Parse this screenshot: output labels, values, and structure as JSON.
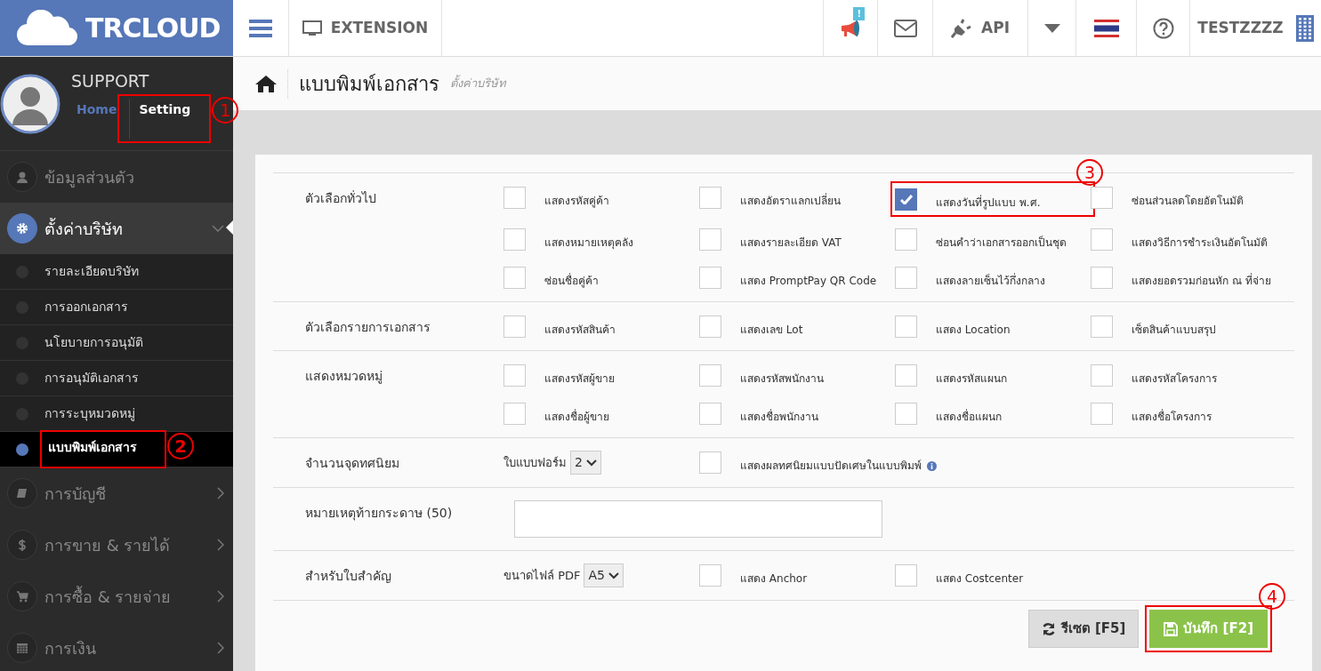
{
  "brand": {
    "name": "TRCLOUD"
  },
  "topbar": {
    "extension": "EXTENSION",
    "notification_badge": "!",
    "api": "API",
    "user": "TESTZZZZ"
  },
  "profile": {
    "name": "SUPPORT",
    "links": [
      {
        "label": "Home",
        "selected": false
      },
      {
        "label": "Setting",
        "selected": true,
        "callout": "1"
      }
    ]
  },
  "sidebar": {
    "items": [
      {
        "label": "ข้อมูลส่วนตัว"
      },
      {
        "label": "ตั้งค่าบริษัท",
        "expanded": true,
        "children": [
          {
            "label": "รายละเอียดบริษัท",
            "selected": false
          },
          {
            "label": "การออกเอกสาร",
            "selected": false
          },
          {
            "label": "นโยบายการอนุมัติ",
            "selected": false
          },
          {
            "label": "การอนุมัติเอกสาร",
            "selected": false
          },
          {
            "label": "การระบุหมวดหมู่",
            "selected": false
          },
          {
            "label": "แบบพิมพ์เอกสาร",
            "selected": true,
            "callout": "2"
          }
        ]
      },
      {
        "label": "การบัญชี",
        "expanded": false
      },
      {
        "label": "การขาย & รายได้",
        "expanded": false
      },
      {
        "label": "การซื้อ & รายจ่าย",
        "expanded": false
      },
      {
        "label": "การเงิน",
        "expanded": false
      }
    ]
  },
  "page": {
    "title": "แบบพิมพ์เอกสาร",
    "subtitle": "ตั้งค่าบริษัท"
  },
  "form": {
    "sections": [
      {
        "label": "ตัวเลือกทั่วไป",
        "items": [
          {
            "kind": "checkbox",
            "label": "แสดงรหัสคู่ค้า",
            "checked": false
          },
          {
            "kind": "checkbox",
            "label": "แสดงอัตราแลกเปลี่ยน",
            "checked": false
          },
          {
            "kind": "checkbox",
            "label": "แสดงวันที่รูปแบบ พ.ศ.",
            "checked": true,
            "callout": "3"
          },
          {
            "kind": "checkbox",
            "label": "ซ่อนส่วนลดโดยอัตโนมัติ",
            "checked": false
          },
          {
            "kind": "checkbox",
            "label": "แสดงหมายเหตุคลัง",
            "checked": false
          },
          {
            "kind": "checkbox",
            "label": "แสดงรายละเอียด VAT",
            "checked": false
          },
          {
            "kind": "checkbox",
            "label": "ซ่อนคำว่าเอกสารออกเป็นชุด",
            "checked": false
          },
          {
            "kind": "checkbox",
            "label": "แสดงวิธีการชำระเงินอัตโนมัติ",
            "checked": false
          },
          {
            "kind": "checkbox",
            "label": "ซ่อนชื่อคู่ค้า",
            "checked": false
          },
          {
            "kind": "checkbox",
            "label": "แสดง PromptPay QR Code",
            "checked": false
          },
          {
            "kind": "checkbox",
            "label": "แสดงลายเซ็นไว้กึ่งกลาง",
            "checked": false
          },
          {
            "kind": "checkbox",
            "label": "แสดงยอดรวมก่อนหัก ณ ที่จ่าย",
            "checked": false
          }
        ]
      },
      {
        "label": "ตัวเลือกรายการเอกสาร",
        "items": [
          {
            "kind": "checkbox",
            "label": "แสดงรหัสสินค้า",
            "checked": false
          },
          {
            "kind": "checkbox",
            "label": "แสดงเลข Lot",
            "checked": false
          },
          {
            "kind": "checkbox",
            "label": "แสดง Location",
            "checked": false
          },
          {
            "kind": "checkbox",
            "label": "เซ็ตสินค้าแบบสรุป",
            "checked": false
          }
        ]
      },
      {
        "label": "แสดงหมวดหมู่",
        "items": [
          {
            "kind": "checkbox",
            "label": "แสดงรหัสผู้ขาย",
            "checked": false
          },
          {
            "kind": "checkbox",
            "label": "แสดงรหัสพนักงาน",
            "checked": false
          },
          {
            "kind": "checkbox",
            "label": "แสดงรหัสแผนก",
            "checked": false
          },
          {
            "kind": "checkbox",
            "label": "แสดงรหัสโครงการ",
            "checked": false
          },
          {
            "kind": "checkbox",
            "label": "แสดงชื่อผู้ขาย",
            "checked": false
          },
          {
            "kind": "checkbox",
            "label": "แสดงชื่อพนักงาน",
            "checked": false
          },
          {
            "kind": "checkbox",
            "label": "แสดงชื่อแผนก",
            "checked": false
          },
          {
            "kind": "checkbox",
            "label": "แสดงชื่อโครงการ",
            "checked": false
          }
        ]
      },
      {
        "label": "จำนวนจุดทศนิยม",
        "items": [
          {
            "kind": "select",
            "label": "ใบแบบฟอร์ม",
            "value": "2"
          },
          {
            "kind": "checkbox",
            "label": "แสดงผลทศนิยมแบบปัดเศษในแบบพิมพ์",
            "checked": false,
            "info": true
          }
        ]
      },
      {
        "label": "หมายเหตุท้ายกระดาษ (50)",
        "items": [
          {
            "kind": "text"
          }
        ]
      },
      {
        "label": "สำหรับใบสำคัญ",
        "items": [
          {
            "kind": "select",
            "label": "ขนาดไฟล์ PDF",
            "value": "A5"
          },
          {
            "kind": "checkbox",
            "label": "แสดง Anchor",
            "checked": false
          },
          {
            "kind": "checkbox",
            "label": "แสดง Costcenter",
            "checked": false
          }
        ]
      }
    ]
  },
  "buttons": [
    {
      "label": "รีเซต [F5]",
      "kind": "reset"
    },
    {
      "label": "บันทึก [F2]",
      "kind": "save",
      "callout": "4"
    }
  ]
}
